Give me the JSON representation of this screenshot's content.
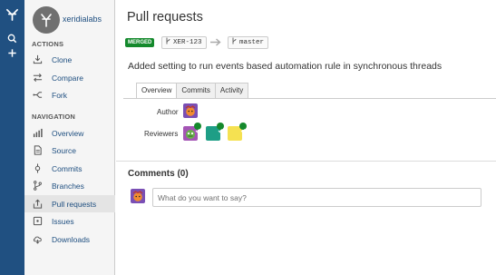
{
  "project": {
    "name": "xeridialabs"
  },
  "sidebar": {
    "actions_heading": "ACTIONS",
    "actions": [
      {
        "label": "Clone",
        "icon": "download-icon"
      },
      {
        "label": "Compare",
        "icon": "compare-icon"
      },
      {
        "label": "Fork",
        "icon": "fork-icon"
      }
    ],
    "navigation_heading": "NAVIGATION",
    "navigation": [
      {
        "label": "Overview",
        "icon": "overview-icon"
      },
      {
        "label": "Source",
        "icon": "source-icon"
      },
      {
        "label": "Commits",
        "icon": "commit-icon"
      },
      {
        "label": "Branches",
        "icon": "branch-icon"
      },
      {
        "label": "Pull requests",
        "icon": "pull-request-icon",
        "active": true
      },
      {
        "label": "Issues",
        "icon": "issues-icon"
      },
      {
        "label": "Downloads",
        "icon": "cloud-icon"
      }
    ]
  },
  "page": {
    "title": "Pull requests",
    "status_badge": "MERGED",
    "source_branch": "XER-123",
    "target_branch": "master",
    "description": "Added setting to run events based automation rule in synchronous threads"
  },
  "tabs": [
    {
      "label": "Overview",
      "active": true
    },
    {
      "label": "Commits",
      "active": false
    },
    {
      "label": "Activity",
      "active": false
    }
  ],
  "overview": {
    "author_label": "Author",
    "reviewers_label": "Reviewers"
  },
  "comments": {
    "heading": "Comments (0)",
    "placeholder": "What do you want to say?"
  },
  "colors": {
    "global_nav": "#205081",
    "link": "#205081",
    "merged": "#14892c",
    "reviewer_teal": "#1e9e86",
    "reviewer_yellow": "#f5e151"
  }
}
